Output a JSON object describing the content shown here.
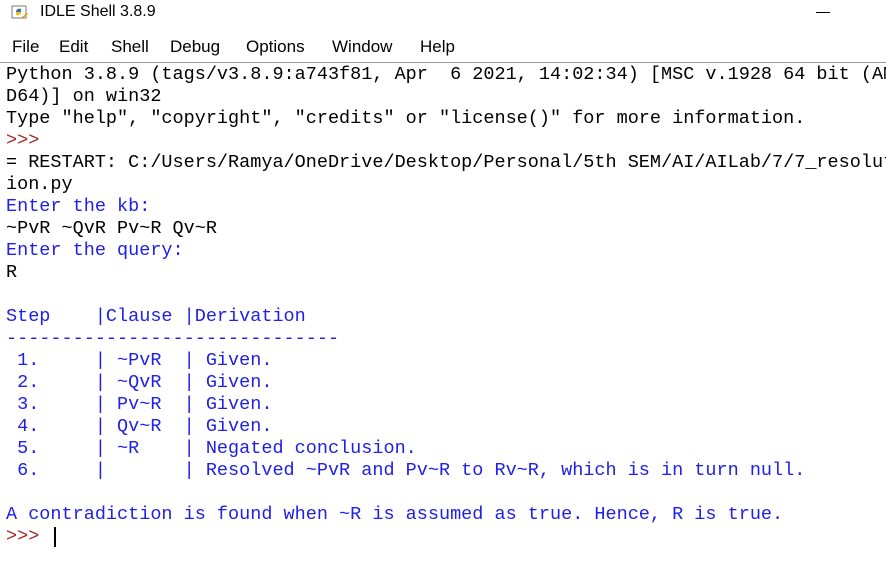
{
  "window": {
    "title": "IDLE Shell 3.8.9",
    "icon": "python-idle-icon"
  },
  "menu": [
    "File",
    "Edit",
    "Shell",
    "Debug",
    "Options",
    "Window",
    "Help"
  ],
  "shell": {
    "lines": [
      {
        "text": "Python 3.8.9 (tags/v3.8.9:a743f81, Apr  6 2021, 14:02:34) [MSC v.1928 64 bit (AM",
        "style": "out"
      },
      {
        "text": "D64)] on win32",
        "style": "out"
      },
      {
        "text": "Type \"help\", \"copyright\", \"credits\" or \"license()\" for more information.",
        "style": "out"
      },
      {
        "text": ">>> ",
        "style": "prompt"
      },
      {
        "text": "= RESTART: C:/Users/Ramya/OneDrive/Desktop/Personal/5th SEM/AI/AILab/7/7_resolut",
        "style": "out"
      },
      {
        "text": "ion.py",
        "style": "out"
      },
      {
        "text": "Enter the kb:",
        "style": "blue"
      },
      {
        "text": "~PvR ~QvR Pv~R Qv~R",
        "style": "out"
      },
      {
        "text": "Enter the query:",
        "style": "blue"
      },
      {
        "text": "R",
        "style": "out"
      },
      {
        "text": "",
        "style": "out"
      },
      {
        "text": "Step    |Clause |Derivation",
        "style": "blue"
      },
      {
        "text": "------------------------------",
        "style": "blue"
      },
      {
        "text": " 1.     | ~PvR  | Given.",
        "style": "blue"
      },
      {
        "text": " 2.     | ~QvR  | Given.",
        "style": "blue"
      },
      {
        "text": " 3.     | Pv~R  | Given.",
        "style": "blue"
      },
      {
        "text": " 4.     | Qv~R  | Given.",
        "style": "blue"
      },
      {
        "text": " 5.     | ~R    | Negated conclusion.",
        "style": "blue"
      },
      {
        "text": " 6.     |       | Resolved ~PvR and Pv~R to Rv~R, which is in turn null.",
        "style": "blue"
      },
      {
        "text": "",
        "style": "out"
      },
      {
        "text": "A contradiction is found when ~R is assumed as true. Hence, R is true.",
        "style": "blue"
      },
      {
        "text": ">>> ",
        "style": "prompt"
      }
    ]
  }
}
